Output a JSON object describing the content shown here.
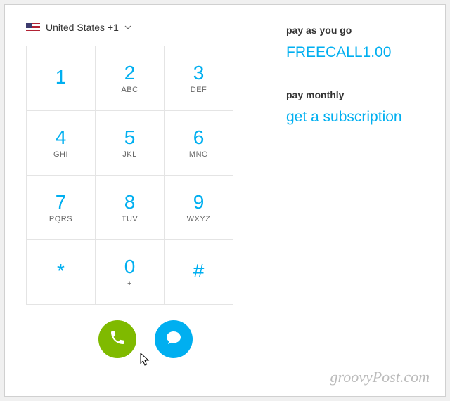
{
  "country": {
    "label": "United States +1"
  },
  "dialpad": [
    {
      "digit": "1",
      "letters": ""
    },
    {
      "digit": "2",
      "letters": "ABC"
    },
    {
      "digit": "3",
      "letters": "DEF"
    },
    {
      "digit": "4",
      "letters": "GHI"
    },
    {
      "digit": "5",
      "letters": "JKL"
    },
    {
      "digit": "6",
      "letters": "MNO"
    },
    {
      "digit": "7",
      "letters": "PQRS"
    },
    {
      "digit": "8",
      "letters": "TUV"
    },
    {
      "digit": "9",
      "letters": "WXYZ"
    },
    {
      "digit": "*",
      "letters": ""
    },
    {
      "digit": "0",
      "letters": "+"
    },
    {
      "digit": "#",
      "letters": ""
    }
  ],
  "payg": {
    "label": "pay as you go",
    "value": "FREECALL1.00"
  },
  "monthly": {
    "label": "pay monthly",
    "link": "get a subscription"
  },
  "watermark": "groovyPost.com",
  "colors": {
    "accent": "#00aff0",
    "call": "#7fba00"
  }
}
